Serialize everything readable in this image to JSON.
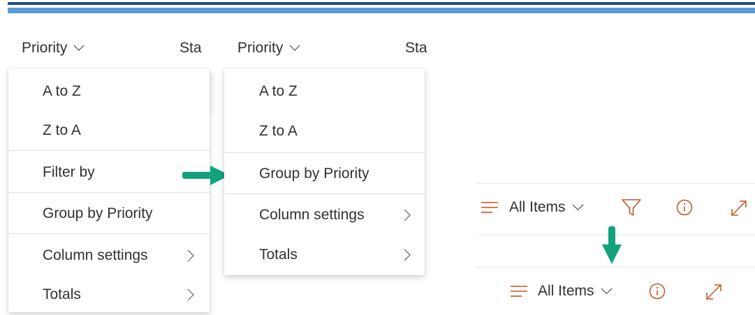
{
  "colors": {
    "accent_orange": "#c8511d",
    "arrow_teal": "#12a37d",
    "top_stripe_dark": "#1f4e79",
    "top_stripe_light": "#5b9bd5"
  },
  "left_panel": {
    "column_header": "Priority",
    "next_column_header": "Sta",
    "menu_items": [
      {
        "label": "A to Z"
      },
      {
        "label": "Z to A"
      },
      {
        "label": "Filter by"
      },
      {
        "label": "Group by Priority"
      },
      {
        "label": "Column settings",
        "submenu": true
      },
      {
        "label": "Totals",
        "submenu": true
      }
    ]
  },
  "middle_panel": {
    "column_header": "Priority",
    "next_column_header": "Sta",
    "menu_items": [
      {
        "label": "A to Z"
      },
      {
        "label": "Z to A"
      },
      {
        "label": "Group by Priority"
      },
      {
        "label": "Column settings",
        "submenu": true
      },
      {
        "label": "Totals",
        "submenu": true
      }
    ]
  },
  "right_panel": {
    "top_bar": {
      "view_selector_label": "All Items",
      "icons": [
        "view-lines-icon",
        "chevron-down-icon",
        "filter-icon",
        "info-icon",
        "expand-icon"
      ]
    },
    "bottom_bar": {
      "view_selector_label": "All Items",
      "icons": [
        "view-lines-icon",
        "chevron-down-icon",
        "info-icon",
        "expand-icon"
      ]
    }
  }
}
